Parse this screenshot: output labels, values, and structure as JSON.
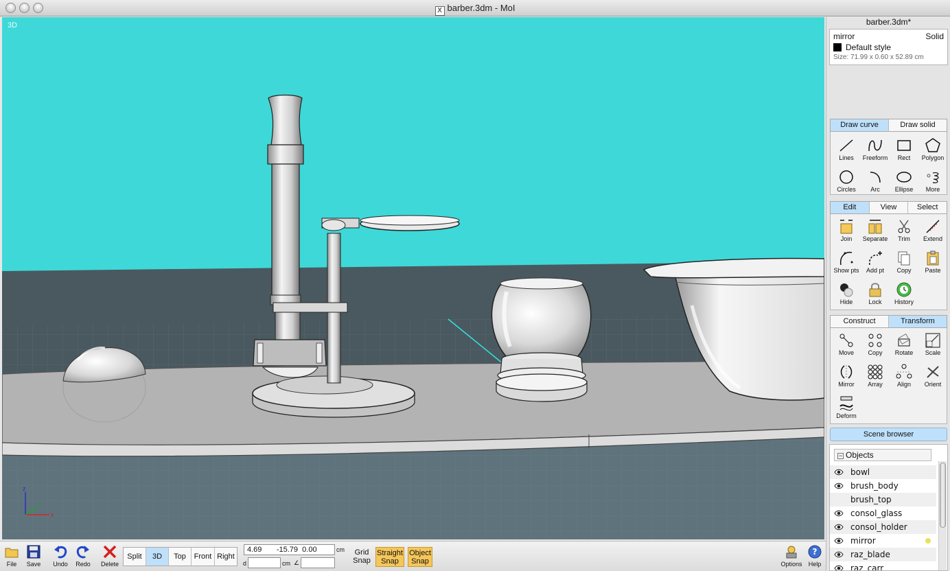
{
  "window": {
    "title": "barber.3dm - MoI",
    "x11_icon": "X"
  },
  "viewport": {
    "label": "3D",
    "axes": {
      "x": "x",
      "y": "y",
      "z": "z"
    },
    "sky_color": "#3fd8d8"
  },
  "panel": {
    "file_name": "barber.3dm*",
    "properties": {
      "name": "mirror",
      "type": "Solid",
      "style": "Default style",
      "size": "Size: 71.99 x 0.60 x 52.89 cm"
    },
    "draw_tabs": [
      "Draw curve",
      "Draw solid"
    ],
    "draw_tools": [
      "Lines",
      "Freeform",
      "Rect",
      "Polygon",
      "Circles",
      "Arc",
      "Ellipse",
      "More"
    ],
    "edit_tabs": [
      "Edit",
      "View",
      "Select"
    ],
    "edit_tools": [
      "Join",
      "Separate",
      "Trim",
      "Extend",
      "Show pts",
      "Add pt",
      "Copy",
      "Paste",
      "Hide",
      "Lock",
      "History"
    ],
    "transform_tabs": [
      "Construct",
      "Transform"
    ],
    "transform_tools": [
      "Move",
      "Copy",
      "Rotate",
      "Scale",
      "Mirror",
      "Array",
      "Align",
      "Orient",
      "Deform"
    ],
    "scene_browser": "Scene browser",
    "objects_label": "Objects",
    "objects": [
      {
        "name": "bowl",
        "visible": true
      },
      {
        "name": "brush_body",
        "visible": true
      },
      {
        "name": "brush_top",
        "visible": false
      },
      {
        "name": "consol_glass",
        "visible": true
      },
      {
        "name": "consol_holder",
        "visible": true
      },
      {
        "name": "mirror",
        "visible": true,
        "selected": true
      },
      {
        "name": "raz_blade",
        "visible": true
      },
      {
        "name": "raz_carr",
        "visible": true
      }
    ]
  },
  "bottom": {
    "file": "File",
    "save": "Save",
    "undo": "Undo",
    "redo": "Redo",
    "delete": "Delete",
    "view_tabs": [
      "Split",
      "3D",
      "Top",
      "Front",
      "Right"
    ],
    "coords": {
      "x": "4.69",
      "y": "-15.79",
      "z": "0.00",
      "unit": "cm"
    },
    "distance_label": "d",
    "distance_unit": "cm",
    "angle_symbol": "∠",
    "distance_value": "",
    "angle_value": "",
    "grid_snap": [
      "Grid",
      "Snap"
    ],
    "straight_snap": [
      "Straight",
      "Snap"
    ],
    "object_snap": [
      "Object",
      "Snap"
    ],
    "options": "Options",
    "help": "Help"
  }
}
